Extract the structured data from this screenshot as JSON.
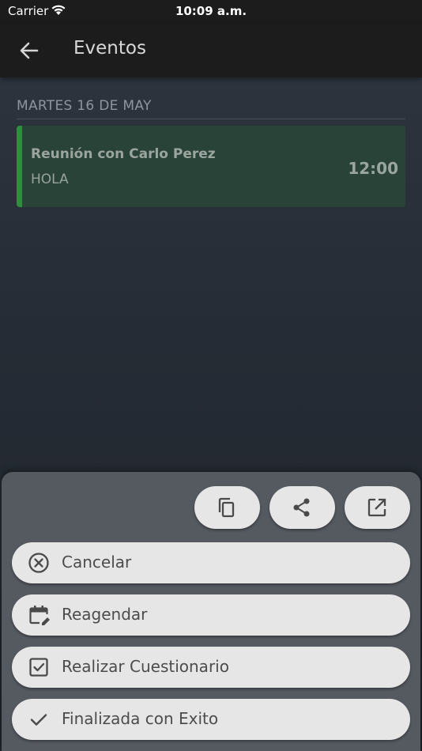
{
  "status_bar": {
    "carrier": "Carrier",
    "time": "10:09 a.m."
  },
  "app_bar": {
    "title": "Eventos"
  },
  "agenda": {
    "date_header": "MARTES 16 DE MAY",
    "events": [
      {
        "title": "Reunión con Carlo Perez",
        "subtitle": "HOLA",
        "time": "12:00",
        "accent_color": "#2f8f3f"
      }
    ]
  },
  "bottom_sheet": {
    "icon_buttons": [
      {
        "icon": "copy-icon"
      },
      {
        "icon": "share-icon"
      },
      {
        "icon": "open-external-icon"
      }
    ],
    "actions": [
      {
        "label": "Cancelar",
        "icon": "cancel-circle-icon"
      },
      {
        "label": "Reagendar",
        "icon": "calendar-edit-icon"
      },
      {
        "label": "Realizar Cuestionario",
        "icon": "checkbox-icon"
      },
      {
        "label": "Finalizada con Exito",
        "icon": "check-icon"
      }
    ]
  }
}
